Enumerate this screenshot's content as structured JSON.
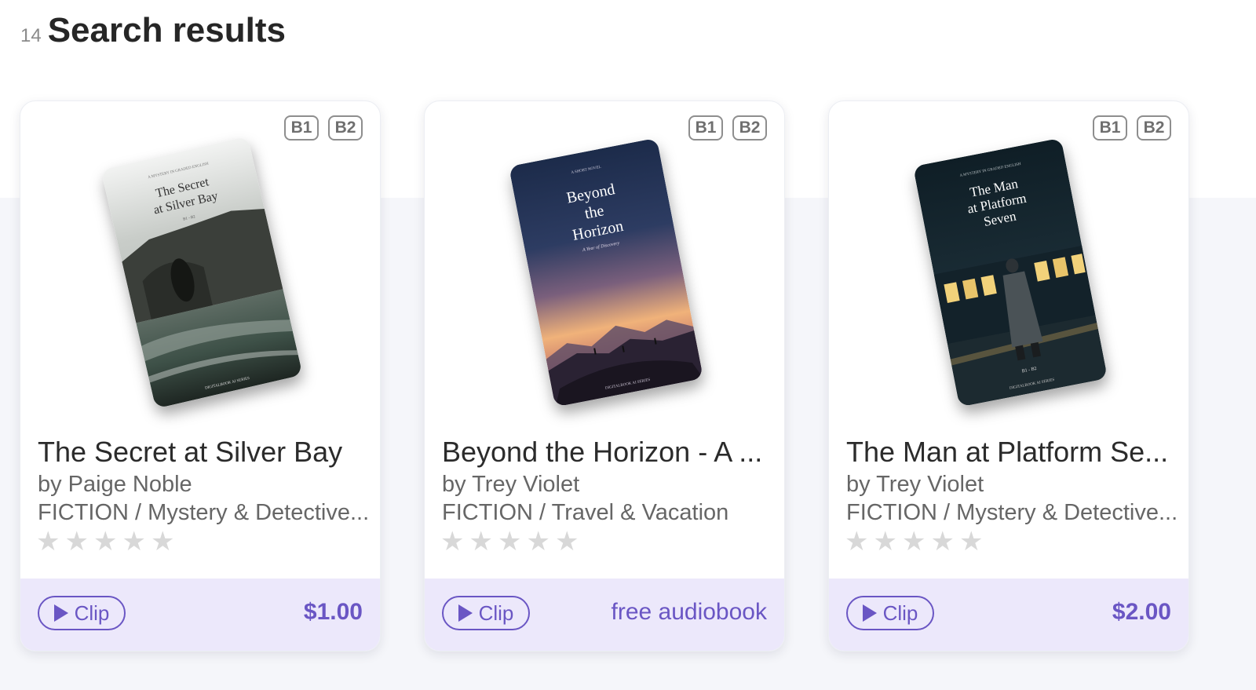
{
  "header": {
    "count": "14",
    "title": "Search results"
  },
  "colors": {
    "accent": "#6a56c4",
    "footer_bg": "#ece8fb",
    "star_empty": "#d8d8d8"
  },
  "cards": [
    {
      "levels": [
        "B1",
        "B2"
      ],
      "cover": {
        "title_line1": "The Secret",
        "title_line2": "at Silver Bay",
        "title_line3": "",
        "subtitle": "B1 - B2",
        "kicker": "A MYSTERY IN GRADED ENGLISH",
        "publisher": "DIGITALBOOK AI SERIES"
      },
      "title": "The Secret at Silver Bay",
      "author": "by Paige Noble",
      "category": "FICTION / Mystery & Detective...",
      "rating": 0,
      "clip_label": "Clip",
      "price": "$1.00"
    },
    {
      "levels": [
        "B1",
        "B2"
      ],
      "cover": {
        "title_line1": "Beyond",
        "title_line2": "the",
        "title_line3": "Horizon",
        "subtitle": "A Year of Discovery",
        "kicker": "A SHORT NOVEL",
        "publisher": "DIGITALBOOK AI SERIES"
      },
      "title": "Beyond the Horizon - A ...",
      "author": "by Trey Violet",
      "category": "FICTION / Travel & Vacation",
      "rating": 0,
      "clip_label": "Clip",
      "price": "free audiobook"
    },
    {
      "levels": [
        "B1",
        "B2"
      ],
      "cover": {
        "title_line1": "The Man",
        "title_line2": "at Platform",
        "title_line3": "Seven",
        "subtitle": "B1 - B2",
        "kicker": "A MYSTERY IN GRADED ENGLISH",
        "publisher": "DIGITALBOOK AI SERIES"
      },
      "title": "The Man at Platform Se...",
      "author": "by Trey Violet",
      "category": "FICTION / Mystery & Detective...",
      "rating": 0,
      "clip_label": "Clip",
      "price": "$2.00"
    }
  ]
}
